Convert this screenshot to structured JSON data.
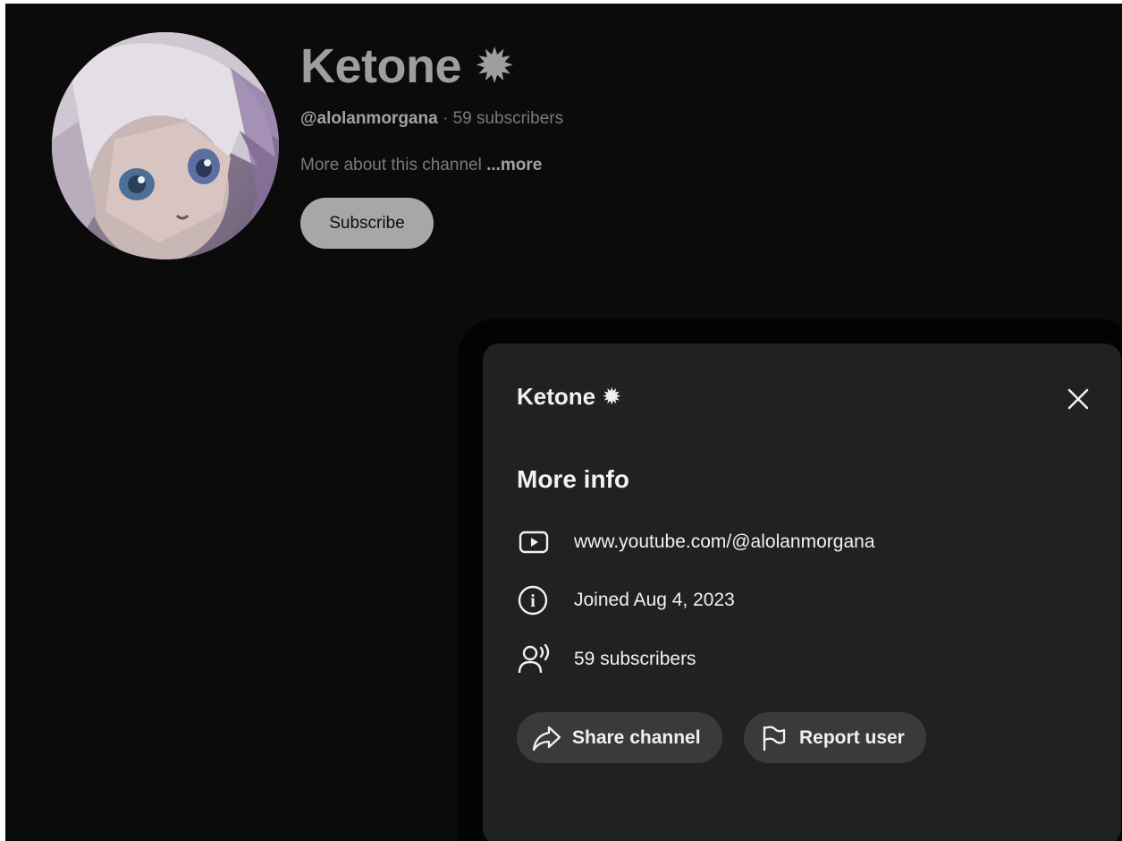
{
  "channel": {
    "name": "Ketone",
    "name_symbol": "✹",
    "handle": "@alolanmorgana",
    "separator": " · ",
    "subscribers": "59 subscribers",
    "description": "More about this channel ",
    "more_link": "...more",
    "subscribe_label": "Subscribe",
    "avatar_icon": "anime-avatar"
  },
  "dialog": {
    "title": "Ketone",
    "title_symbol": "✹",
    "close_icon": "close-icon",
    "section_title": "More info",
    "rows": [
      {
        "icon": "video-play-icon",
        "text": "www.youtube.com/@alolanmorgana"
      },
      {
        "icon": "info-icon",
        "text": "Joined Aug 4, 2023"
      },
      {
        "icon": "subscribers-icon",
        "text": "59 subscribers"
      }
    ],
    "actions": {
      "share_label": "Share channel",
      "share_icon": "share-arrow-icon",
      "report_label": "Report user",
      "report_icon": "flag-icon"
    }
  },
  "colors": {
    "page_bg": "#0b0b0b",
    "dialog_bg": "#212121",
    "pill_bg": "#3a3a3a",
    "text_primary": "#f1f1f1"
  }
}
